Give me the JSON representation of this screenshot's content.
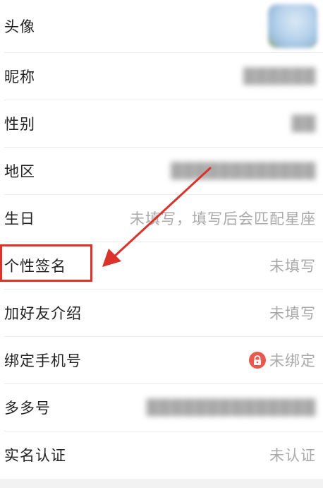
{
  "profile": {
    "rows": [
      {
        "label": "头像",
        "value": "",
        "kind": "avatar"
      },
      {
        "label": "昵称",
        "value": "",
        "kind": "blurred"
      },
      {
        "label": "性别",
        "value": "",
        "kind": "blurred"
      },
      {
        "label": "地区",
        "value": "",
        "kind": "blurred"
      },
      {
        "label": "生日",
        "value": "未填写，填写后会匹配星座",
        "kind": "text"
      },
      {
        "label": "个性签名",
        "value": "未填写",
        "kind": "text"
      },
      {
        "label": "加好友介绍",
        "value": "未填写",
        "kind": "text"
      },
      {
        "label": "绑定手机号",
        "value": "未绑定",
        "kind": "locked"
      },
      {
        "label": "多多号",
        "value": "",
        "kind": "blurred"
      },
      {
        "label": "实名认证",
        "value": "未认证",
        "kind": "text"
      }
    ]
  },
  "annotation": {
    "color": "#d9332b",
    "target_row": "个性签名"
  },
  "icons": {
    "lock": "lock-icon",
    "avatar": "avatar-image"
  }
}
